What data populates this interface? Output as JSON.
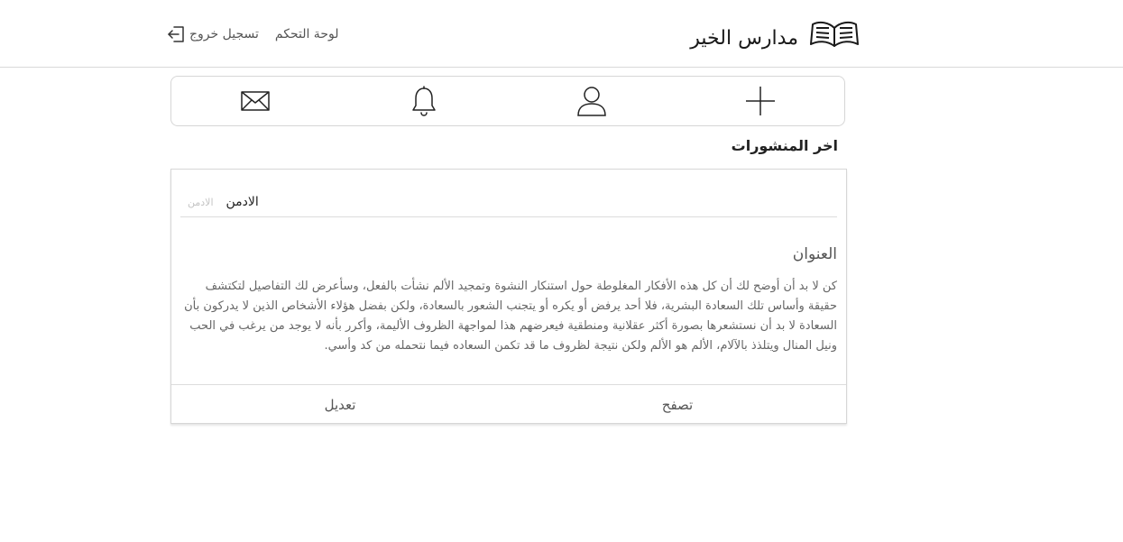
{
  "header": {
    "brand_name": "مدارس الخير",
    "brand_icon": "open-book-icon",
    "nav": {
      "dashboard_label": "لوحة التحكم",
      "logout_label": "تسجيل خروج",
      "logout_icon": "sign-out-icon"
    }
  },
  "icon_bar": {
    "items": [
      {
        "icon": "envelope-icon"
      },
      {
        "icon": "bell-icon"
      },
      {
        "icon": "user-icon"
      },
      {
        "icon": "plus-icon"
      }
    ]
  },
  "main": {
    "section_title": "اخر المنشورات",
    "posts": [
      {
        "author_small": "الادمن",
        "author_name": "الادمن",
        "title": "العنوان",
        "body": "كن لا بد أن أوضح لك أن كل هذه الأفكار المغلوطة حول استنكار النشوة وتمجيد الألم نشأت بالفعل، وسأعرض لك التفاصيل لتكتشف حقيقة وأساس تلك السعادة البشرية، فلا أحد يرفض أو يكره أو يتجنب الشعور بالسعادة، ولكن بفضل هؤلاء الأشخاص الذين لا يدركون بأن السعادة لا بد أن نستشعرها بصورة أكثر عقلانية ومنطقية فيعرضهم هذا لمواجهة الظروف الأليمة، وأكرر بأنه لا يوجد من يرغب في الحب ونيل المنال ويتلذذ بالآلام، الألم هو الألم ولكن نتيجة لظروف ما قد تكمن السعاده فيما نتحمله من كد وأسي.",
        "browse_label": "تصفح",
        "edit_label": "تعديل"
      }
    ]
  }
}
